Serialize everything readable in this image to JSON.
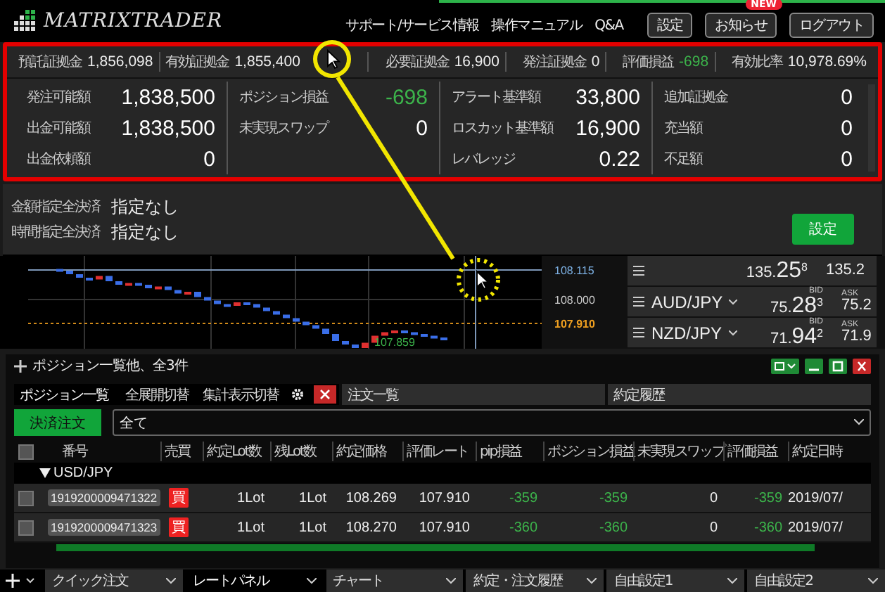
{
  "header": {
    "logo": "MATRIXTRADER",
    "links": [
      "サポート/サービス情報",
      "操作マニュアル",
      "Q&A"
    ],
    "buttons": [
      {
        "label": "設定"
      },
      {
        "label": "お知らせ",
        "badge": "NEW"
      },
      {
        "label": "ログアウト"
      }
    ]
  },
  "summary": [
    {
      "label": "預託証拠金",
      "value": "1,856,098",
      "highlight": false
    },
    {
      "label": "有効証拠金",
      "value": "1,855,400",
      "highlight": false
    },
    {
      "label": "必要証拠金",
      "value": "16,900",
      "highlight": false
    },
    {
      "label": "発注証拠金",
      "value": "0",
      "highlight": false
    },
    {
      "label": "評価損益",
      "value": "-698",
      "highlight": true
    },
    {
      "label": "有効比率",
      "value": "10,978.69%",
      "highlight": false
    }
  ],
  "account_columns": [
    [
      {
        "label": "発注可能額",
        "value": "1,838,500",
        "highlight": false
      },
      {
        "label": "出金可能額",
        "value": "1,838,500",
        "highlight": false
      },
      {
        "label": "出金依頼額",
        "value": "0",
        "highlight": false
      }
    ],
    [
      {
        "label": "ポジション損益",
        "value": "-698",
        "highlight": true
      },
      {
        "label": "未実現スワップ",
        "value": "0",
        "highlight": false
      }
    ],
    [
      {
        "label": "アラート基準額",
        "value": "33,800",
        "highlight": false
      },
      {
        "label": "ロスカット基準額",
        "value": "16,900",
        "highlight": false
      },
      {
        "label": "レバレッジ",
        "value": "0.22",
        "highlight": false
      }
    ],
    [
      {
        "label": "追加証拠金",
        "value": "0",
        "highlight": false
      },
      {
        "label": "充当額",
        "value": "0",
        "highlight": false
      },
      {
        "label": "不足額",
        "value": "0",
        "highlight": false
      }
    ]
  ],
  "auto_settlement": {
    "rows": [
      {
        "label": "金額指定全決済",
        "value": "指定なし"
      },
      {
        "label": "時間指定全決済",
        "value": "指定なし"
      }
    ],
    "button": "設定"
  },
  "chart": {
    "price_labels": [
      {
        "kind": "line",
        "text": "108.115"
      },
      {
        "kind": "tick",
        "text": "108.000"
      },
      {
        "kind": "current",
        "text": "107.910"
      }
    ],
    "low_label": "107.859"
  },
  "rate_panel": [
    {
      "bid_head": "135.",
      "bid_big": "25",
      "bid_pip": "8",
      "ask": "135.2"
    },
    {
      "pair": "AUD/JPY",
      "bid_label": "BID",
      "bid_head": "75.",
      "bid_big": "28",
      "bid_pip": "3",
      "ask_label": "ASK",
      "ask": "75.2"
    },
    {
      "pair": "NZD/JPY",
      "bid_label": "BID",
      "bid_head": "71.",
      "bid_big": "94",
      "bid_pip": "2",
      "ask_label": "ASK",
      "ask": "71.9"
    }
  ],
  "position_window": {
    "title": "ポジション一覧他、全3件",
    "tabs": [
      {
        "label": "ポジション一覧",
        "selected": true
      },
      {
        "label": "注文一覧",
        "selected": false
      },
      {
        "label": "約定履歴",
        "selected": false
      }
    ],
    "toggles": [
      "全展開切替",
      "集計表示切替"
    ],
    "settle_button": "決済注文",
    "filter": "全て",
    "columns": [
      "番号",
      "売買",
      "約定Lot数",
      "残Lot数",
      "約定価格",
      "評価レート",
      "pip損益",
      "ポジション損益",
      "未実現スワップ",
      "評価損益",
      "約定日時"
    ],
    "header_checked": false,
    "groups": [
      {
        "name": "USD/JPY",
        "expanded": true,
        "rows": [
          {
            "checked": false,
            "number": "1919200009471322",
            "side": "買",
            "lot": "1Lot",
            "remaining": "1Lot",
            "price": "108.269",
            "rate": "107.910",
            "pip": "-359",
            "pl": "-359",
            "swap": "0",
            "eval": "-359",
            "date": "2019/07/"
          },
          {
            "checked": false,
            "number": "1919200009471323",
            "side": "買",
            "lot": "1Lot",
            "remaining": "1Lot",
            "price": "108.270",
            "rate": "107.910",
            "pip": "-360",
            "pl": "-360",
            "swap": "0",
            "eval": "-360",
            "date": "2019/07/"
          }
        ]
      }
    ]
  },
  "bottom_tabs": [
    {
      "label": "クイック注文",
      "selected": false
    },
    {
      "label": "レートパネル",
      "selected": true
    },
    {
      "label": "チャート",
      "selected": false
    },
    {
      "label": "約定・注文履歴",
      "selected": false
    },
    {
      "label": "自由設定1",
      "selected": false
    },
    {
      "label": "自由設定2",
      "selected": false
    }
  ]
}
